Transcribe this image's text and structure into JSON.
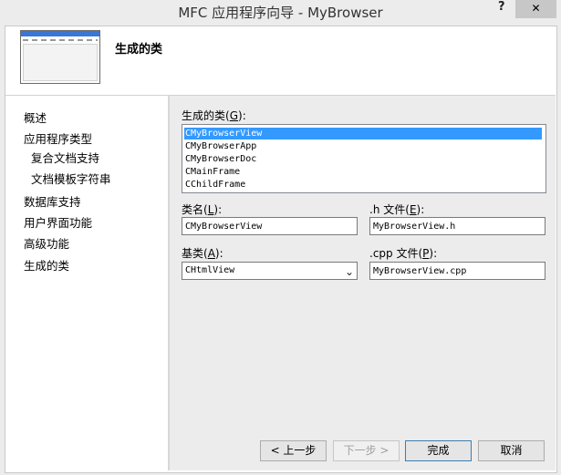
{
  "window": {
    "title": "MFC 应用程序向导 - MyBrowser",
    "help": "?",
    "close": "✕"
  },
  "header": {
    "page_title": "生成的类"
  },
  "nav": {
    "items": [
      "概述",
      "应用程序类型",
      "复合文档支持",
      "文档模板字符串",
      "数据库支持",
      "用户界面功能",
      "高级功能",
      "生成的类"
    ]
  },
  "generated_classes": {
    "label": "生成的类",
    "accel": "G",
    "items": [
      "CMyBrowserView",
      "CMyBrowserApp",
      "CMyBrowserDoc",
      "CMainFrame",
      "CChildFrame"
    ],
    "selected": "CMyBrowserView"
  },
  "class_name": {
    "label": "类名",
    "accel": "L",
    "value": "CMyBrowserView"
  },
  "h_file": {
    "label": ".h 文件",
    "accel": "E",
    "value": "MyBrowserView.h"
  },
  "base_class": {
    "label": "基类",
    "accel": "A",
    "value": "CHtmlView"
  },
  "cpp_file": {
    "label": ".cpp 文件",
    "accel": "P",
    "value": "MyBrowserView.cpp"
  },
  "buttons": {
    "prev": "< 上一步",
    "next": "下一步 >",
    "finish": "完成",
    "cancel": "取消"
  }
}
